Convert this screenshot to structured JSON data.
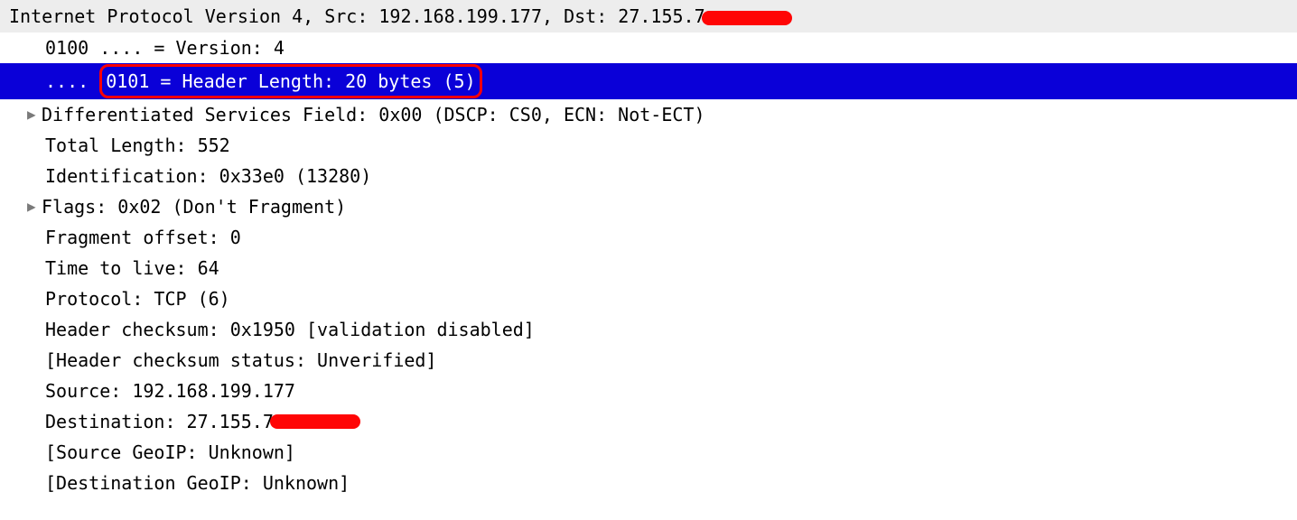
{
  "header": {
    "prefix": "Internet Protocol Version 4, Src: 192.168.199.177, Dst: 27.155.7"
  },
  "fields": {
    "version": "0100 .... = Version: 4",
    "header_length_prefix": "....",
    "header_length_main": "0101 = Header Length: 20 bytes (5)",
    "dsf": "Differentiated Services Field: 0x00 (DSCP: CS0, ECN: Not-ECT)",
    "total_length": "Total Length: 552",
    "identification": "Identification: 0x33e0 (13280)",
    "flags": "Flags: 0x02 (Don't Fragment)",
    "fragment_offset": "Fragment offset: 0",
    "ttl": "Time to live: 64",
    "protocol": "Protocol: TCP (6)",
    "checksum": "Header checksum: 0x1950 [validation disabled]",
    "checksum_status": "[Header checksum status: Unverified]",
    "source": "Source: 192.168.199.177",
    "destination_prefix": "Destination: 27.155.7",
    "source_geoip": "[Source GeoIP: Unknown]",
    "dest_geoip": "[Destination GeoIP: Unknown]"
  }
}
